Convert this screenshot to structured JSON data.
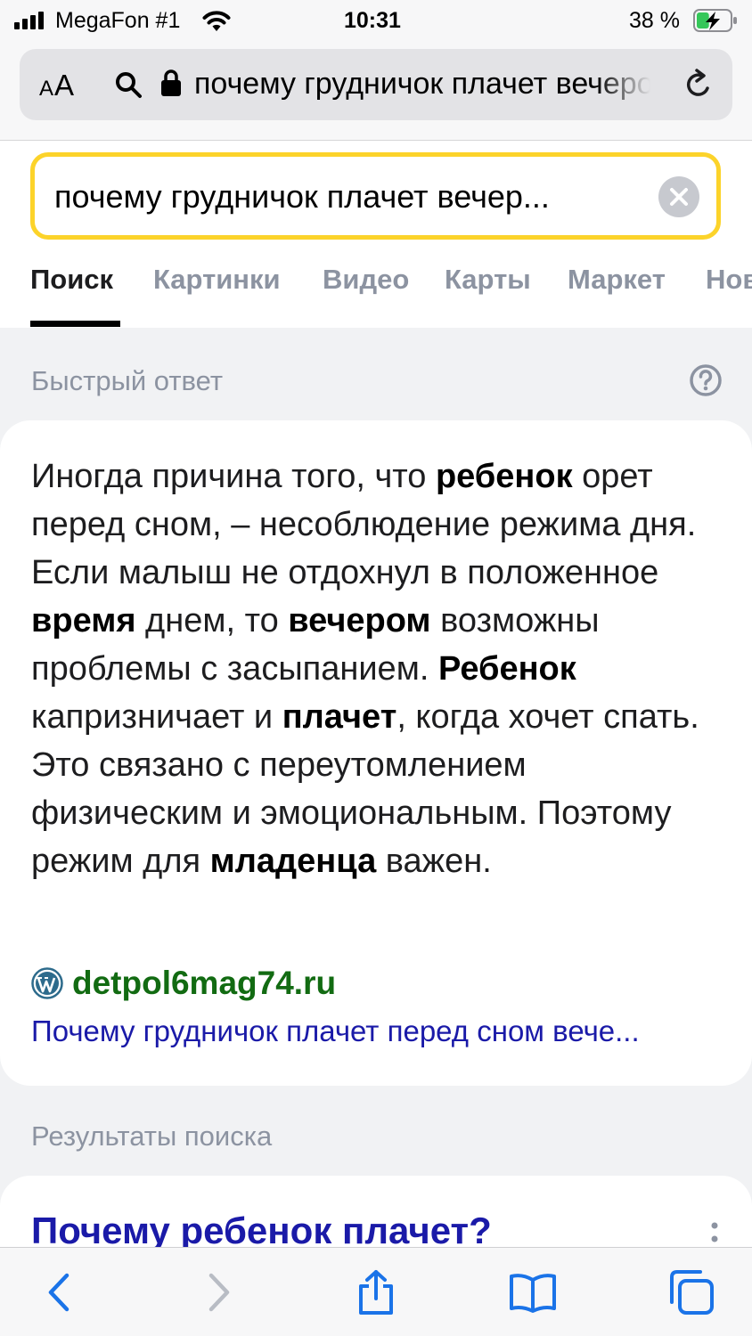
{
  "status_bar": {
    "carrier": "MegaFon #1",
    "time": "10:31",
    "battery_percent": "38 %",
    "battery_level": 0.38,
    "battery_state": "charging"
  },
  "browser": {
    "aa_label_big": "A",
    "aa_label_small": "A",
    "aa_label": "AA",
    "url_text": "почему грудничок плачет вечером"
  },
  "search": {
    "query": "почему грудничок плачет вечер..."
  },
  "tabs": [
    {
      "label": "Поиск",
      "active": true
    },
    {
      "label": "Картинки",
      "active": false
    },
    {
      "label": "Видео",
      "active": false
    },
    {
      "label": "Карты",
      "active": false
    },
    {
      "label": "Маркет",
      "active": false
    },
    {
      "label": "Нов",
      "active": false
    }
  ],
  "quick_answer": {
    "label": "Быстрый ответ",
    "segments": [
      {
        "text": "Иногда причина того, что ",
        "bold": false
      },
      {
        "text": "ребенок",
        "bold": true
      },
      {
        "text": " орет перед сном, – несоблюдение режима дня. Если малыш не отдохнул в положенное ",
        "bold": false
      },
      {
        "text": "время",
        "bold": true
      },
      {
        "text": " днем, то ",
        "bold": false
      },
      {
        "text": "вечером",
        "bold": true
      },
      {
        "text": " возможны проблемы с засыпанием. ",
        "bold": false
      },
      {
        "text": "Ребенок",
        "bold": true
      },
      {
        "text": " капризничает и ",
        "bold": false
      },
      {
        "text": "плачет",
        "bold": true
      },
      {
        "text": ", когда хочет спать. Это связано с переутомлением физическим и эмоциональным. Поэтому режим для ",
        "bold": false
      },
      {
        "text": "младенца",
        "bold": true
      },
      {
        "text": " важен.",
        "bold": false
      }
    ],
    "source_domain": "detpol6mag74.ru",
    "source_title": "Почему грудничок плачет перед сном вече..."
  },
  "results": {
    "label": "Результаты поиска",
    "first_title": "Почему ребенок плачет?"
  },
  "colors": {
    "search_border": "#fcd32a",
    "link_blue": "#1a1aa8",
    "domain_green": "#126b12",
    "toolbar_blue": "#1a73e8"
  },
  "icons": {
    "url_search": "search-icon",
    "lock": "lock-icon",
    "reload": "reload-icon",
    "clear": "clear-icon",
    "help": "help-icon",
    "wordpress": "wordpress-icon",
    "more": "more-vertical-icon",
    "back": "back-icon",
    "forward": "forward-icon",
    "share": "share-icon",
    "bookmarks": "bookmarks-icon",
    "tabs": "tabs-icon"
  }
}
